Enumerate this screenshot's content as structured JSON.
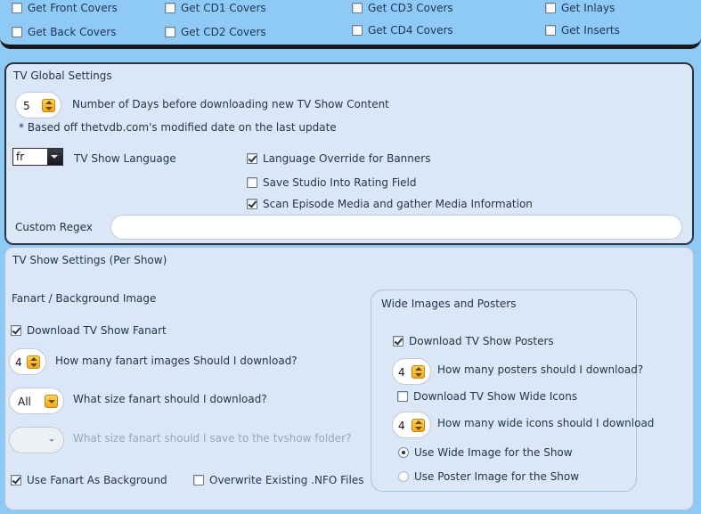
{
  "covers": {
    "front": {
      "label": "Get Front Covers",
      "checked": false
    },
    "back": {
      "label": "Get Back Covers",
      "checked": false
    },
    "cd1": {
      "label": "Get CD1 Covers",
      "checked": false
    },
    "cd2": {
      "label": "Get CD2 Covers",
      "checked": false
    },
    "cd3": {
      "label": "Get CD3 Covers",
      "checked": false
    },
    "cd4": {
      "label": "Get CD4 Covers",
      "checked": false
    },
    "inlays": {
      "label": "Get Inlays",
      "checked": false
    },
    "inserts": {
      "label": "Get Inserts",
      "checked": false
    }
  },
  "global": {
    "title": "TV Global Settings",
    "days_value": "5",
    "days_label": "Number of Days before  downloading new TV Show Content",
    "days_note": "* Based off thetvdb.com's modified date on the last update",
    "language_value": "fr",
    "language_label": "TV Show Language",
    "lang_override": {
      "label": "Language Override for Banners",
      "checked": true
    },
    "save_studio": {
      "label": "Save Studio Into Rating Field",
      "checked": false
    },
    "scan_media": {
      "label": "Scan Episode Media and gather Media Information",
      "checked": true
    },
    "regex_label": "Custom Regex",
    "regex_value": ""
  },
  "show": {
    "title": "TV Show Settings (Per Show)",
    "fanart_heading": "Fanart / Background Image",
    "download_fanart": {
      "label": "Download TV Show Fanart",
      "checked": true
    },
    "fanart_count_value": "4",
    "fanart_count_label": "How many fanart images Should I download?",
    "fanart_size_value": "All",
    "fanart_size_label": "What size fanart should I download?",
    "save_size_value": "",
    "save_size_label": "What size fanart should I save to the tvshow folder?",
    "use_fanart_bg": {
      "label": "Use Fanart As Background",
      "checked": true
    },
    "overwrite_nfo": {
      "label": "Overwrite Existing .NFO Files",
      "checked": false
    },
    "wide": {
      "heading": "Wide Images and Posters",
      "download_posters": {
        "label": "Download TV Show Posters",
        "checked": true
      },
      "posters_count_value": "4",
      "posters_count_label": "How many posters should I download?",
      "download_wide": {
        "label": "Download TV Show Wide Icons",
        "checked": false
      },
      "wide_count_value": "4",
      "wide_count_label": "How many wide icons should I download",
      "use_wide": {
        "label": "Use Wide Image for the Show",
        "selected": true
      },
      "use_poster": {
        "label": "Use Poster Image for the Show",
        "selected": false
      }
    }
  }
}
